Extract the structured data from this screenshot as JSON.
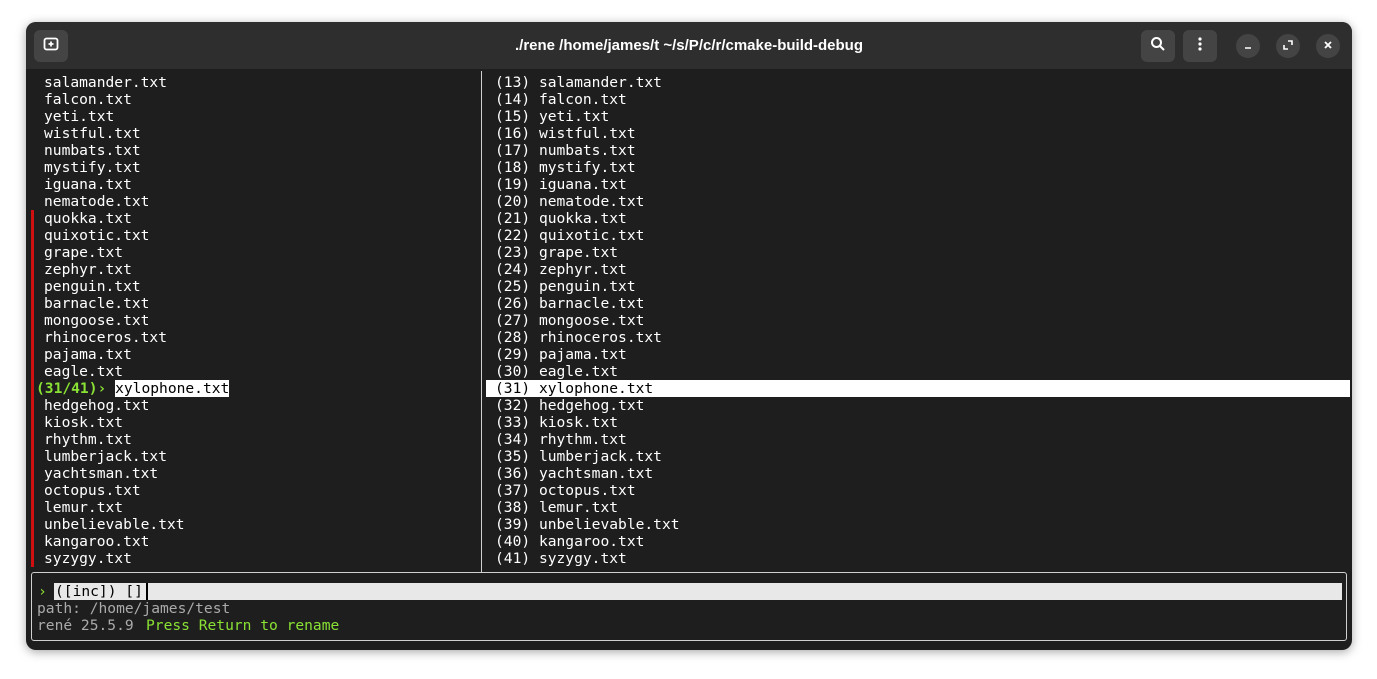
{
  "window": {
    "title": "./rene /home/james/t ~/s/P/c/r/cmake-build-debug"
  },
  "titlebar": {
    "new_tab_icon": "new-tab-icon",
    "search_icon": "search-icon",
    "menu_icon": "kebab-menu-icon",
    "minimize_icon": "minimize-icon",
    "maximize_icon": "maximize-icon",
    "close_icon": "close-icon"
  },
  "left_pane": {
    "files_before": [
      "salamander.txt",
      "falcon.txt",
      "yeti.txt",
      "wistful.txt",
      "numbats.txt",
      "mystify.txt",
      "iguana.txt",
      "nematode.txt",
      "quokka.txt",
      "quixotic.txt",
      "grape.txt",
      "zephyr.txt",
      "penguin.txt",
      "barnacle.txt",
      "mongoose.txt",
      "rhinoceros.txt",
      "pajama.txt",
      "eagle.txt"
    ],
    "current": {
      "counter": "(31/41)",
      "arrow": "›",
      "file": "xylophone.txt"
    },
    "files_after": [
      "hedgehog.txt",
      "kiosk.txt",
      "rhythm.txt",
      "lumberjack.txt",
      "yachtsman.txt",
      "octopus.txt",
      "lemur.txt",
      "unbelievable.txt",
      "kangaroo.txt",
      "syzygy.txt"
    ]
  },
  "right_pane": {
    "rows": [
      {
        "n": "(13)",
        "f": "salamander.txt"
      },
      {
        "n": "(14)",
        "f": "falcon.txt"
      },
      {
        "n": "(15)",
        "f": "yeti.txt"
      },
      {
        "n": "(16)",
        "f": "wistful.txt"
      },
      {
        "n": "(17)",
        "f": "numbats.txt"
      },
      {
        "n": "(18)",
        "f": "mystify.txt"
      },
      {
        "n": "(19)",
        "f": "iguana.txt"
      },
      {
        "n": "(20)",
        "f": "nematode.txt"
      },
      {
        "n": "(21)",
        "f": "quokka.txt"
      },
      {
        "n": "(22)",
        "f": "quixotic.txt"
      },
      {
        "n": "(23)",
        "f": "grape.txt"
      },
      {
        "n": "(24)",
        "f": "zephyr.txt"
      },
      {
        "n": "(25)",
        "f": "penguin.txt"
      },
      {
        "n": "(26)",
        "f": "barnacle.txt"
      },
      {
        "n": "(27)",
        "f": "mongoose.txt"
      },
      {
        "n": "(28)",
        "f": "rhinoceros.txt"
      },
      {
        "n": "(29)",
        "f": "pajama.txt"
      },
      {
        "n": "(30)",
        "f": "eagle.txt"
      },
      {
        "n": "(31)",
        "f": "xylophone.txt"
      },
      {
        "n": "(32)",
        "f": "hedgehog.txt"
      },
      {
        "n": "(33)",
        "f": "kiosk.txt"
      },
      {
        "n": "(34)",
        "f": "rhythm.txt"
      },
      {
        "n": "(35)",
        "f": "lumberjack.txt"
      },
      {
        "n": "(36)",
        "f": "yachtsman.txt"
      },
      {
        "n": "(37)",
        "f": "octopus.txt"
      },
      {
        "n": "(38)",
        "f": "lemur.txt"
      },
      {
        "n": "(39)",
        "f": "unbelievable.txt"
      },
      {
        "n": "(40)",
        "f": "kangaroo.txt"
      },
      {
        "n": "(41)",
        "f": "syzygy.txt"
      }
    ],
    "selected_row": "(31)"
  },
  "prompt": {
    "arrow": "›",
    "input_value": "([inc]) []",
    "path_line": "path: /home/james/test",
    "version": "rené 25.5.9",
    "hint": "Press Return to rename"
  },
  "colors": {
    "accent_green": "#8ae234",
    "marker_red": "#d01010",
    "background": "#1e1e1e",
    "titlebar": "#2e2e2e"
  }
}
